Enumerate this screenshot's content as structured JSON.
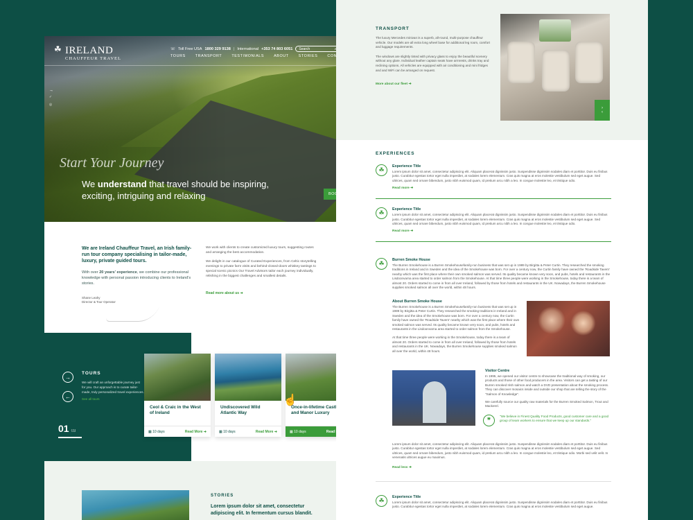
{
  "colors": {
    "brand_dark": "#0d4f45",
    "accent_green": "#3b9c3a",
    "page_bg": "#0d4f45"
  },
  "left": {
    "logo": {
      "name": "IRELAND",
      "sub": "CHAUFFEUR TRAVEL",
      "icon": "shamrock-icon"
    },
    "topbar": {
      "tollfree_label": "Toll Free USA",
      "tollfree_number": "1800 329 9138",
      "intl_label": "International",
      "intl_number": "+353 74 803 6051",
      "search_placeholder": "Search"
    },
    "nav": [
      "TOURS",
      "TRANSPORT",
      "TESTIMONIALS",
      "ABOUT",
      "STORIES",
      "CONTACT"
    ],
    "hero": {
      "script": "Start Your Journey",
      "line_pre": "We ",
      "line_bold": "understand",
      "line_post": " that travel should be inspiring, exciting, intriguing and relaxing",
      "book_label": "BOOK"
    },
    "intro": {
      "heading": "We are Ireland Chauffeur Travel, an Irish family-run tour company specialising in tailor-made, luxury, private guided tours.",
      "para_pre": "With over ",
      "para_bold": "20 years' experience",
      "para_post": ", we combine our professional knowledge with personal passion introducing clients to Ireland's stories.",
      "sig_name": "Shane Leahy",
      "sig_title": "Director & Tour Operator",
      "right_p1": "We work with clients to create customized luxury tours, suggesting routes and arranging the best accommodation.",
      "right_p2": "We delight in our catalogue of Curated Experiences, from Celtic storytelling evenings to private farm visits and behind-closed-doors whiskey tastings to special scenic picnics Our Travel Advisors tailor each journey individually, relishing in the biggest challenges and smallest details.",
      "right_more": "Read more about us"
    },
    "tours": {
      "heading": "TOURS",
      "text": "We will craft an unforgettable journey just for you. Our approach is to curate tailor-made, truly personalized travel experiences.",
      "all_link": "See all tours",
      "page_current": "01",
      "page_total": "03",
      "cards": [
        {
          "title": "Ceol & Craic in the West of Ireland",
          "days": "10 days",
          "link": "Read More"
        },
        {
          "title": "Undiscovered Wild Atlantic Way",
          "days": "10 days",
          "link": "Read More"
        },
        {
          "title": "Once-in-lifetime Castle and Manor Luxury",
          "days": "10 days",
          "link": "Read More"
        }
      ]
    },
    "stories": {
      "heading": "STORIES",
      "text": "Lorem ipsum dolor sit amet, consectetur adipiscing elit. In fermentum cursus blandit."
    }
  },
  "right": {
    "transport": {
      "heading": "TRANSPORT",
      "p1": "The luxury Mercedes minivan is a superb, all-round, multi-purpose chauffeur vehicle. Our models are all extra long wheel base for additional leg room, comfort and luggage requirements.",
      "p2": "The windows are slightly tinted with privacy glass to enjoy the beautiful scenery without any glare. Individual leather captain seats have armrests, drinks tray and reclining options. All vehicles are equipped with air conditioning and mini fridges and and WiFi can be arranged on request.",
      "more": "More about our fleet"
    },
    "experiences": {
      "heading": "EXPERIENCES",
      "items": [
        {
          "title": "Experience Title",
          "text": "Lorem ipsum dolor sit amet, consectetur adipiscing elit. Aliquam placerat dignissim justo. Suspendisse dignissim sodales diam et porttitor. Duis eu finibus justo. Curabitur egestas tortor eget nulla imperdiet, at sodales lorem elementum. Cras quis magna at eros molestie vestibulum sed eget augue. Sed ultrices, quam sed ornare bibendum, justo nibh euismod quam, id pretium arcu nibh a leo. In congue molestie leo, et tristique odio.",
          "link": "Read more"
        },
        {
          "title": "Experience Title",
          "text": "Lorem ipsum dolor sit amet, consectetur adipiscing elit. Aliquam placerat dignissim justo. Suspendisse dignissim sodales diam et porttitor. Duis eu finibus justo. Curabitur egestas tortor eget nulla imperdiet, at sodales lorem elementum. Cras quis magna at eros molestie vestibulum sed eget augue. Sed ultrices, quam sed ornare bibendum, justo nibh euismod quam, id pretium arcu nibh a leo. In congue molestie leo, et tristique odio.",
          "link": "Read more"
        }
      ],
      "burren_title": "Burren Smoke House",
      "burren_text": "The Burren Smokehouse is a Burren Smokehousefamily-run business that was set up in 1989 by Birgitta & Peter Curtin. They researched the smoking traditions in Ireland and in Sweden and the idea of the Smokehouse was born. For over a century now, the Curtin family have owned the 'Roadside Tavern' nearby which was the first place where their own smoked salmon was served. Its quality became known very soon, and pubs, hotels and restaurants in the Lisdoonvarna area started to order salmon from the Smokehouse. At that time three people were working in the Smokehouse, today there is a team of almost 20. Orders started to come in from all over Ireland, followed by those from hotels and restaurants in the UK. Nowadays, the Burren Smokehouse supplies smoked salmon all over the world, within 48 hours.",
      "about_title": "About Burren Smoke House",
      "about_text": "The Burren Smokehouse is a Burren Smokehousefamily-run business that was set up in 1989 by Birgitta & Peter Curtin. They researched the smoking traditions in Ireland and in Sweden and the idea of the Smokehouse was born. For over a century now, the Curtin family have owned the 'Roadside Tavern' nearby which was the first place where their own smoked salmon was served. Its quality became known very soon, and pubs, hotels and restaurants in the Lisdoonvarna area started to order salmon from the Smokehouse.",
      "about_text2": "At that time three people were working in the Smokehouse, today there is a team of almost 20. Orders started to come in from all over Ireland, followed by those from hotels and restaurants in the UK. Nowadays, the Burren Smokehouse supplies smoked salmon all over the world, within 48 hours.",
      "visit_title": "Visitor Centre",
      "visit_text": "In 1995, we opened our visitor centre to showcase the traditional way of smoking, our products and those of other food producers in the area. Visitors can get a tasting of our Burren smoked Irish salmon and watch a DVD presentation about the smoking process. They can discover mosaics inside and outside our shop that are telling the story of the \"Salmon of Knowledge\".",
      "visit_text2": "We carefully source our quality raw materials for the Burren Smoked Salmon, Trout and Mackerel.",
      "quote": "\"We believe in Finest Quality Food Products, good customer care and a good group of team workers to ensure that we keep up our standards.\"",
      "tail_text": "Lorem ipsum dolor sit amet, consectetur adipiscing elit. Aliquam placerat dignissim justo. Suspendisse dignissim sodales diam et porttitor. Duis eu finibus justo. Curabitur egestas tortor eget nulla imperdiet, at sodales lorem elementum. Cras quis magna at eros molestie vestibulum sed eget augue. Sed ultrices, quam sed ornare bibendum, justo nibh euismod quam, id pretium arcu nibh a leo. In congue molestie leo, et tristique odio. Morbi sed velit velit. In venenatis ultrices augue eu maximus.",
      "read_less": "Read less",
      "last_title": "Experience Title",
      "last_text": "Lorem ipsum dolor sit amet, consectetur adipiscing elit. Aliquam placerat dignissim justo. Suspendisse dignissim sodales diam et porttitor. Duis eu finibus justo. Curabitur egestas tortor eget nulla imperdiet, at sodales lorem elementum. Cras quis magna at eros molestie vestibulum sed eget augue."
    }
  }
}
